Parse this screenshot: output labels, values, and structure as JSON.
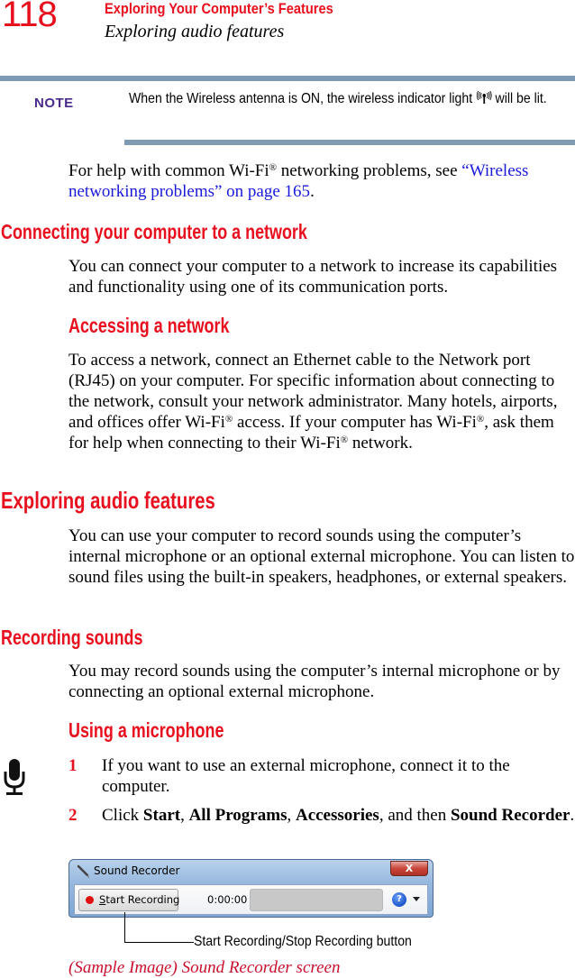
{
  "header": {
    "page_number": "118",
    "chapter": "Exploring Your Computer’s Features",
    "section": "Exploring audio features"
  },
  "note": {
    "label": "NOTE",
    "text_before_icon": "When the Wireless antenna is ON, the wireless indicator light",
    "icon": "wireless-antenna-icon",
    "text_after_icon": "will be lit."
  },
  "help_paragraph": {
    "text_before": "For help with common Wi-Fi",
    "reg": "®",
    "text_middle": " networking problems, see ",
    "link_text": "“Wireless networking problems” on page 165",
    "text_after": "."
  },
  "sections": {
    "connecting": {
      "heading": "Connecting your computer to a network",
      "body": "You can connect your computer to a network to increase its capabilities and functionality using one of its communication ports."
    },
    "accessing": {
      "heading": "Accessing a network",
      "body_parts": [
        "To access a network, connect an Ethernet cable to the Network port (RJ45) on your computer. For specific information about connecting to the network, consult your network administrator. Many hotels, airports, and offices offer Wi-Fi",
        " access. If your computer has Wi-Fi",
        ", ask them for help when connecting to their Wi-Fi",
        " network."
      ],
      "reg": "®"
    },
    "audio": {
      "heading": "Exploring audio features",
      "body": "You can use your computer to record sounds using the computer’s internal microphone or an optional external microphone. You can listen to sound files using the built-in speakers, headphones, or external speakers."
    },
    "recording": {
      "heading": "Recording sounds",
      "body": "You may record sounds using the computer’s internal microphone or by connecting an optional external microphone."
    },
    "microphone": {
      "heading": "Using a microphone",
      "icon": "microphone-icon",
      "steps": [
        {
          "num": "1",
          "text": "If you want to use an external microphone, connect it to the computer."
        },
        {
          "num": "2",
          "parts": [
            {
              "t": "Click ",
              "b": false
            },
            {
              "t": "Start",
              "b": true
            },
            {
              "t": ", ",
              "b": false
            },
            {
              "t": "All Programs",
              "b": true
            },
            {
              "t": ", ",
              "b": false
            },
            {
              "t": "Accessories",
              "b": true
            },
            {
              "t": ", and then ",
              "b": false
            },
            {
              "t": "Sound Recorder",
              "b": true
            },
            {
              "t": ".",
              "b": false
            }
          ]
        }
      ]
    }
  },
  "sound_recorder": {
    "title": "Sound Recorder",
    "close_label": "X",
    "record_button_label": "Start Recording",
    "record_button_accel": "S",
    "record_button_rest": "tart Recording",
    "time": "0:00:00",
    "help_label": "?",
    "callout": "Start Recording/Stop Recording button"
  },
  "caption": "(Sample Image) Sound Recorder screen",
  "colors": {
    "heading_red": "#e8101e",
    "rule_blue": "#7f9bb3",
    "note_purple": "#4a2a8c",
    "link_blue": "#1a1adb"
  }
}
